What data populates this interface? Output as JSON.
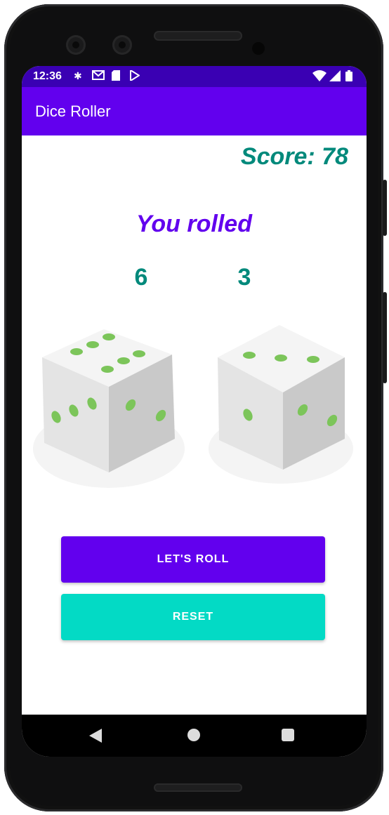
{
  "status_bar": {
    "time": "12:36",
    "left_icons": [
      "settings-icon",
      "gmail-icon",
      "sd-card-icon",
      "play-store-icon"
    ],
    "right_icons": [
      "wifi-icon",
      "signal-icon",
      "battery-icon"
    ]
  },
  "app_bar": {
    "title": "Dice Roller"
  },
  "score_text": "Score: 78",
  "rolled_label": "You rolled",
  "dice": [
    {
      "value": "6"
    },
    {
      "value": "3"
    }
  ],
  "buttons": {
    "roll_label": "LET'S ROLL",
    "reset_label": "RESET"
  },
  "colors": {
    "primary": "#6200ee",
    "primary_dark": "#3a00b3",
    "accent": "#03dac5",
    "score_teal": "#00897b",
    "pip_green": "#7cc55a"
  },
  "nav_bar": {
    "icons": [
      "back-icon",
      "home-icon",
      "recents-icon"
    ]
  }
}
